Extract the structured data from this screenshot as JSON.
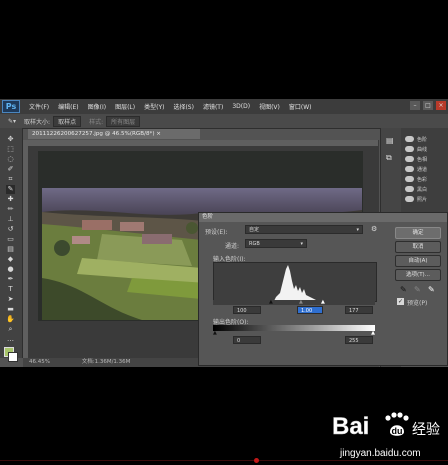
{
  "menubar": {
    "logo": "Ps",
    "items": [
      "文件(F)",
      "编辑(E)",
      "图像(I)",
      "图层(L)",
      "类型(Y)",
      "选择(S)",
      "滤镜(T)",
      "3D(D)",
      "视图(V)",
      "窗口(W)"
    ],
    "window_buttons": [
      "–",
      "□",
      "×"
    ]
  },
  "optbar": {
    "sample_label": "取样大小:",
    "sample_value": "取样点",
    "extra_label": "样式:",
    "extra_value": "所有图层"
  },
  "document": {
    "tab_title": "20111226200627257.jpg @ 46.5%(RGB/8*) ×"
  },
  "status": {
    "zoom": "46.45%",
    "doc_info": "文档:1.36M/1.36M"
  },
  "adjustments_panel": {
    "items": [
      "色阶",
      "曲线",
      "色相",
      "通道",
      "色彩",
      "黑白",
      "照片"
    ]
  },
  "levels_dialog": {
    "title": "色阶",
    "preset_label": "预设(E):",
    "preset_value": "自定",
    "channel_label": "通道:",
    "channel_value": "RGB",
    "input_label": "输入色阶(I):",
    "input_black": "100",
    "input_gamma": "1.00",
    "input_white": "177",
    "output_label": "输出色阶(O):",
    "output_black": "0",
    "output_white": "255",
    "buttons": {
      "ok": "确定",
      "cancel": "取消",
      "auto": "自动(A)",
      "options": "选项(T)..."
    },
    "preview_label": "预览(P)",
    "preview_checked": true
  },
  "watermark": {
    "brand_left": "Bai",
    "brand_right": "经验",
    "url": "jingyan.baidu.com"
  }
}
